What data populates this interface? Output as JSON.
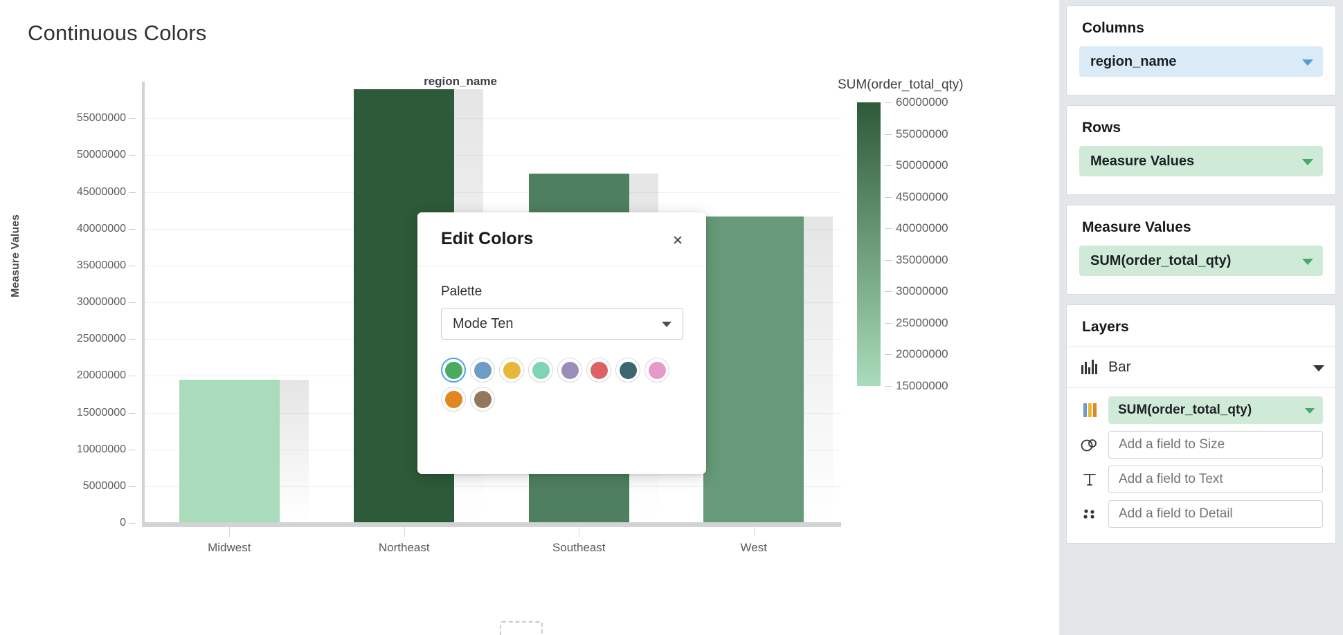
{
  "viz": {
    "title": "Continuous Colors",
    "x_axis_title": "region_name",
    "y_axis_title": "Measure Values"
  },
  "chart_data": {
    "type": "bar",
    "title": "Continuous Colors",
    "xlabel": "region_name",
    "ylabel": "Measure Values",
    "categories": [
      "Midwest",
      "Northeast",
      "Southeast",
      "West"
    ],
    "values": [
      19500000,
      59000000,
      47500000,
      41700000
    ],
    "colors": [
      "#a9dcba",
      "#2d5a38",
      "#4e7f5e",
      "#669a78"
    ],
    "ylim": [
      0,
      60000000
    ],
    "ytick_labels": [
      "0",
      "5000000",
      "10000000",
      "15000000",
      "20000000",
      "25000000",
      "30000000",
      "35000000",
      "40000000",
      "45000000",
      "50000000",
      "55000000"
    ],
    "ytick_values": [
      0,
      5000000,
      10000000,
      15000000,
      20000000,
      25000000,
      30000000,
      35000000,
      40000000,
      45000000,
      50000000,
      55000000
    ],
    "grid": true,
    "legend_position": "right",
    "colorbar": {
      "title": "SUM(order_total_qty)",
      "min": 15000000,
      "max": 60000000,
      "low_color": "#a9dcba",
      "high_color": "#2d5a38",
      "tick_labels": [
        "60000000",
        "55000000",
        "50000000",
        "45000000",
        "40000000",
        "35000000",
        "30000000",
        "25000000",
        "20000000",
        "15000000"
      ],
      "tick_values": [
        60000000,
        55000000,
        50000000,
        45000000,
        40000000,
        35000000,
        30000000,
        25000000,
        20000000,
        15000000
      ]
    }
  },
  "dialog": {
    "title": "Edit Colors",
    "close_label": "×",
    "palette_label": "Palette",
    "palette_value": "Mode Ten",
    "swatches": [
      {
        "name": "green",
        "color": "#4aab5f",
        "selected": true
      },
      {
        "name": "blue",
        "color": "#6f9cc7",
        "selected": false
      },
      {
        "name": "yellow",
        "color": "#e8b73a",
        "selected": false
      },
      {
        "name": "mint",
        "color": "#7fd4b4",
        "selected": false
      },
      {
        "name": "purple",
        "color": "#9c8cba",
        "selected": false
      },
      {
        "name": "red",
        "color": "#dd6265",
        "selected": false
      },
      {
        "name": "teal",
        "color": "#3a6670",
        "selected": false
      },
      {
        "name": "pink",
        "color": "#e79ac8",
        "selected": false
      },
      {
        "name": "orange",
        "color": "#e2861f",
        "selected": false
      },
      {
        "name": "brown",
        "color": "#93775c",
        "selected": false
      }
    ]
  },
  "sidebar": {
    "columns": {
      "title": "Columns",
      "field": "region_name"
    },
    "rows": {
      "title": "Rows",
      "field": "Measure Values"
    },
    "measure_values": {
      "title": "Measure Values",
      "field": "SUM(order_total_qty)"
    },
    "layers": {
      "title": "Layers",
      "mark_type": "Bar",
      "shelves": [
        {
          "icon": "color-icon",
          "value": "SUM(order_total_qty)",
          "filled": true
        },
        {
          "icon": "size-icon",
          "value": "Add a field to Size",
          "filled": false
        },
        {
          "icon": "text-icon",
          "value": "Add a field to Text",
          "filled": false
        },
        {
          "icon": "detail-icon",
          "value": "Add a field to Detail",
          "filled": false
        }
      ]
    }
  }
}
